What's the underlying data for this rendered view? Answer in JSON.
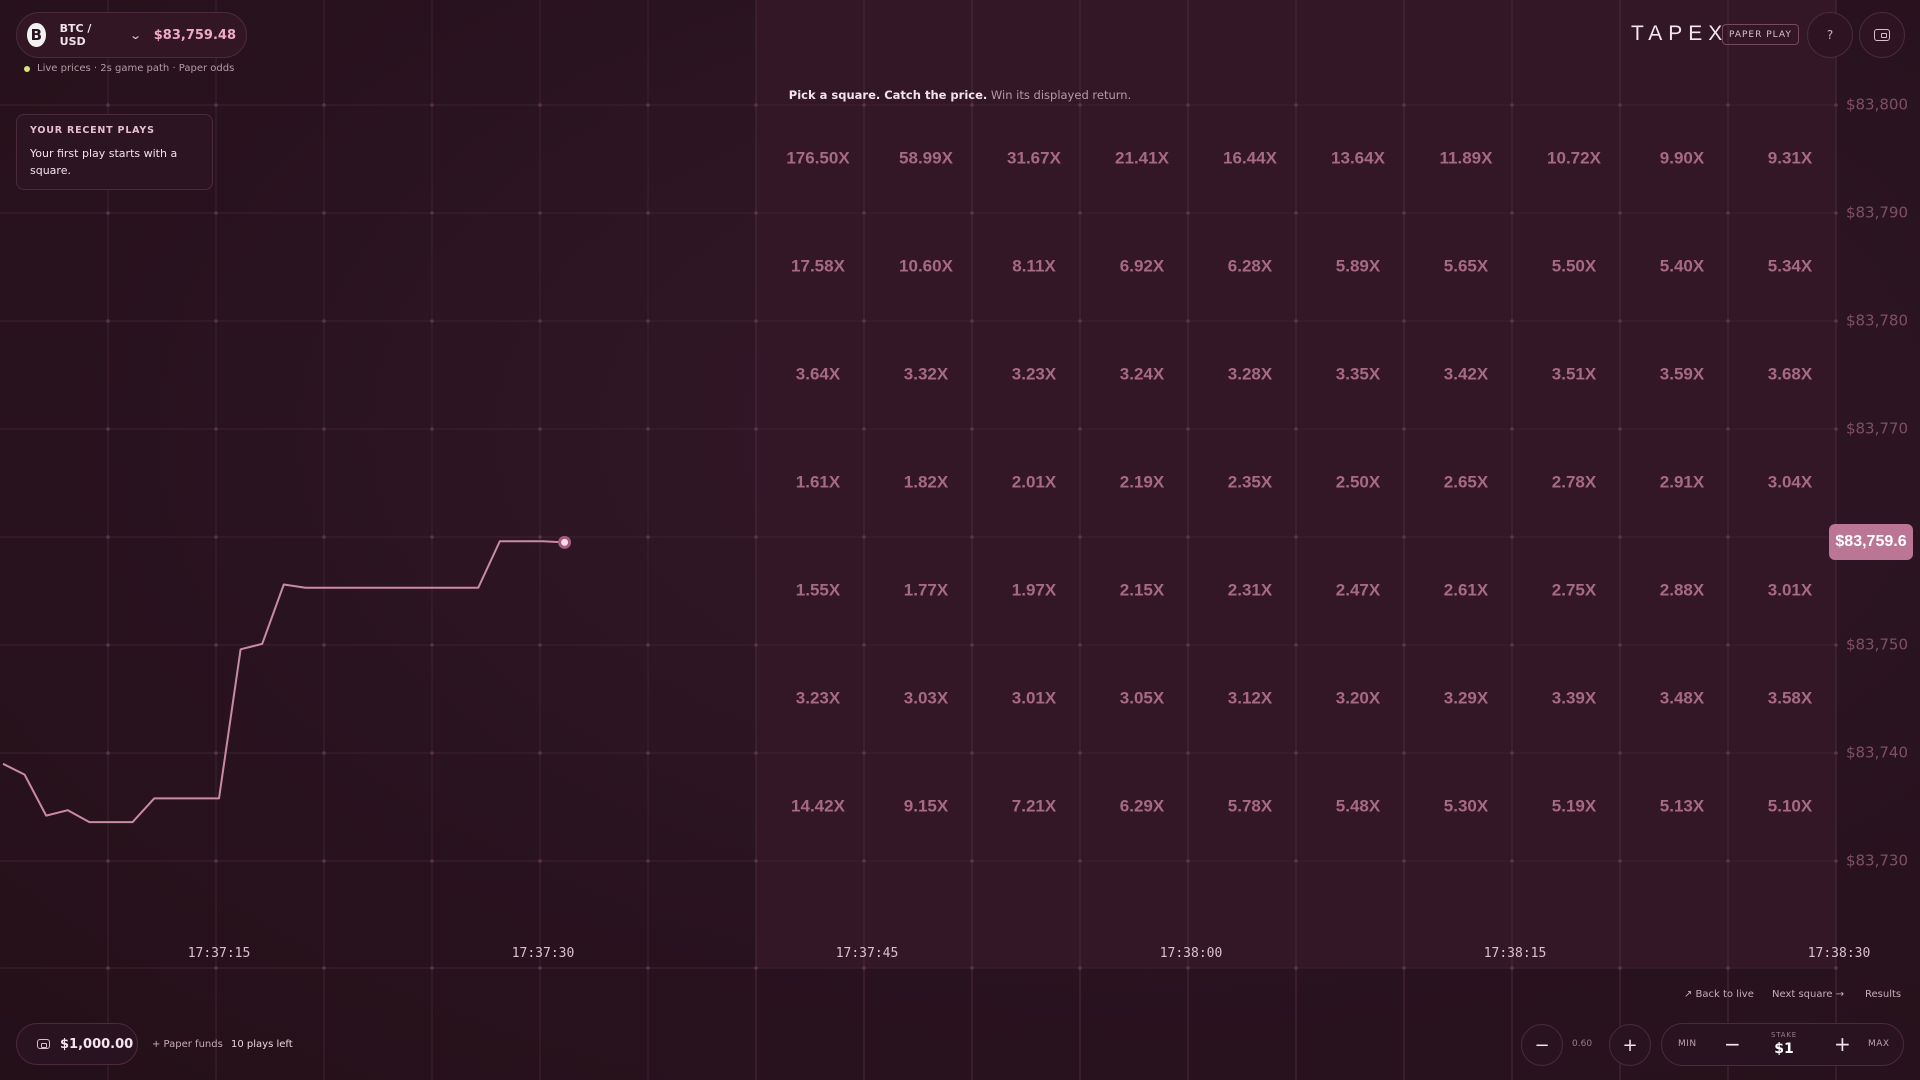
{
  "pair": {
    "coin_glyph": "B",
    "name": "BTC / USD",
    "price": "$83,759.48",
    "chevron": "⌄"
  },
  "status": {
    "text": "Live prices · 2s game path · Paper odds",
    "dot_color": "#d8e27a"
  },
  "recent": {
    "title": "YOUR RECENT PLAYS",
    "text": "Your first play starts with a square."
  },
  "instruction": {
    "bold": "Pick a square. Catch the price.",
    "rest": " Win its displayed return."
  },
  "header": {
    "brand": "TAPEX",
    "badge": "PAPER PLAY",
    "help_label": "?",
    "wallet_icon": "wallet-icon"
  },
  "current_price_tag": "$83,759.6",
  "price_axis": [
    "$83,800",
    "$83,790",
    "$83,780",
    "$83,770",
    "$83,760",
    "$83,750",
    "$83,740",
    "$83,730"
  ],
  "time_axis": [
    "17:37:15",
    "17:37:30",
    "17:37:45",
    "17:38:00",
    "17:38:15",
    "17:38:30"
  ],
  "multiplier_grid": [
    [
      "176.50X",
      "58.99X",
      "31.67X",
      "21.41X",
      "16.44X",
      "13.64X",
      "11.89X",
      "10.72X",
      "9.90X",
      "9.31X"
    ],
    [
      "17.58X",
      "10.60X",
      "8.11X",
      "6.92X",
      "6.28X",
      "5.89X",
      "5.65X",
      "5.50X",
      "5.40X",
      "5.34X"
    ],
    [
      "3.64X",
      "3.32X",
      "3.23X",
      "3.24X",
      "3.28X",
      "3.35X",
      "3.42X",
      "3.51X",
      "3.59X",
      "3.68X"
    ],
    [
      "1.61X",
      "1.82X",
      "2.01X",
      "2.19X",
      "2.35X",
      "2.50X",
      "2.65X",
      "2.78X",
      "2.91X",
      "3.04X"
    ],
    [
      "1.55X",
      "1.77X",
      "1.97X",
      "2.15X",
      "2.31X",
      "2.47X",
      "2.61X",
      "2.75X",
      "2.88X",
      "3.01X"
    ],
    [
      "3.23X",
      "3.03X",
      "3.01X",
      "3.05X",
      "3.12X",
      "3.20X",
      "3.29X",
      "3.39X",
      "3.48X",
      "3.58X"
    ],
    [
      "14.42X",
      "9.15X",
      "7.21X",
      "6.29X",
      "5.78X",
      "5.48X",
      "5.30X",
      "5.19X",
      "5.13X",
      "5.10X"
    ]
  ],
  "price_series": [
    {
      "t": "17:37:05",
      "p": 83739.0
    },
    {
      "t": "17:37:06",
      "p": 83738.0
    },
    {
      "t": "17:37:07",
      "p": 83734.2
    },
    {
      "t": "17:37:08",
      "p": 83734.7
    },
    {
      "t": "17:37:09",
      "p": 83733.6
    },
    {
      "t": "17:37:11",
      "p": 83733.6
    },
    {
      "t": "17:37:12",
      "p": 83735.8
    },
    {
      "t": "17:37:15",
      "p": 83735.8
    },
    {
      "t": "17:37:16",
      "p": 83749.6
    },
    {
      "t": "17:37:17",
      "p": 83750.1
    },
    {
      "t": "17:37:18",
      "p": 83755.6
    },
    {
      "t": "17:37:19",
      "p": 83755.3
    },
    {
      "t": "17:37:27",
      "p": 83755.3
    },
    {
      "t": "17:37:28",
      "p": 83759.6
    },
    {
      "t": "17:37:30",
      "p": 83759.6
    },
    {
      "t": "17:37:31",
      "p": 83759.5
    }
  ],
  "bottom_links": {
    "back": "↗ Back to live",
    "next": "Next square →",
    "results": "Results"
  },
  "funds": {
    "amount": "$1,000.00",
    "add": "+ Paper funds",
    "plays_left": "10 plays left"
  },
  "zoom": {
    "minus": "−",
    "value": "0.60",
    "plus": "+"
  },
  "stake": {
    "min": "MIN",
    "minus": "−",
    "label": "STAKE",
    "value": "$1",
    "plus": "+",
    "max": "MAX"
  },
  "colors": {
    "background": "#2a1320",
    "accent": "#bb7595",
    "price_text": "#f0a9c6",
    "multiplier": "#a66a84"
  }
}
